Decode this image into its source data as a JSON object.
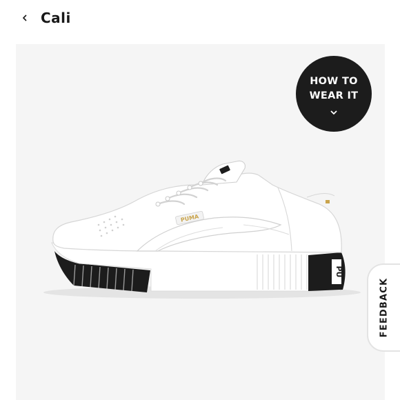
{
  "header": {
    "back_icon": "chevron-left-icon",
    "title": "Cali"
  },
  "product": {
    "image_icon": "sneaker-image",
    "brand_label": "PUMA",
    "heel_label": "PU",
    "colors": {
      "background": "#f5f5f5",
      "shoe_upper": "#ffffff",
      "sole_accent": "#1c1c1c",
      "logo_gold": "#c9a44c"
    }
  },
  "how_to_wear": {
    "line1": "HOW TO",
    "line2": "WEAR IT",
    "icon": "chevron-down-icon"
  },
  "feedback": {
    "label": "FEEDBACK"
  }
}
